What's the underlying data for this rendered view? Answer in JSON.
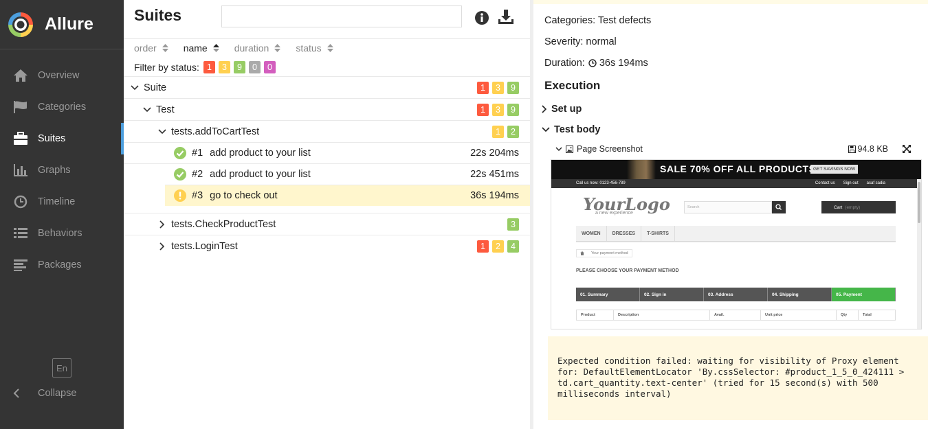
{
  "brand": {
    "name": "Allure"
  },
  "sidebar": {
    "items": [
      {
        "label": "Overview",
        "icon": "home-icon"
      },
      {
        "label": "Categories",
        "icon": "flag-icon"
      },
      {
        "label": "Suites",
        "icon": "briefcase-icon"
      },
      {
        "label": "Graphs",
        "icon": "bar-chart-icon"
      },
      {
        "label": "Timeline",
        "icon": "clock-icon"
      },
      {
        "label": "Behaviors",
        "icon": "list-icon"
      },
      {
        "label": "Packages",
        "icon": "align-left-icon"
      }
    ],
    "active": "Suites",
    "language": "En",
    "collapse_label": "Collapse"
  },
  "suites": {
    "title": "Suites",
    "search_value": "",
    "sorters": [
      {
        "label": "order",
        "active": false
      },
      {
        "label": "name",
        "active": true
      },
      {
        "label": "duration",
        "active": false
      },
      {
        "label": "status",
        "active": false
      }
    ],
    "filter_label": "Filter by status:",
    "filter_counts": {
      "failed": "1",
      "broken": "3",
      "passed": "9",
      "skipped": "0",
      "unknown": "0"
    },
    "tree": {
      "suite": {
        "name": "Suite",
        "badges": [
          "1",
          "3",
          "9"
        ]
      },
      "test": {
        "name": "Test",
        "badges": [
          "1",
          "3",
          "9"
        ]
      },
      "add_to_cart": {
        "name": "tests.addToCartTest",
        "badges": [
          "1",
          "2"
        ]
      },
      "cases": [
        {
          "num": "#1",
          "name": "add product to your list",
          "duration": "22s 204ms",
          "status": "passed"
        },
        {
          "num": "#2",
          "name": "add product to your list",
          "duration": "22s 451ms",
          "status": "passed"
        },
        {
          "num": "#3",
          "name": "go to check out",
          "duration": "36s 194ms",
          "status": "broken"
        }
      ],
      "check_product": {
        "name": "tests.CheckProductTest",
        "badges": [
          "3"
        ]
      },
      "login": {
        "name": "tests.LoginTest",
        "badges": [
          "1",
          "2",
          "4"
        ]
      }
    }
  },
  "detail": {
    "categories": "Categories: Test defects",
    "severity": "Severity: normal",
    "duration_label": "Duration:",
    "duration_value": "36s 194ms",
    "execution_title": "Execution",
    "setup_label": "Set up",
    "body_label": "Test body",
    "attachment": {
      "name": "Page Screenshot",
      "size": "94.8 KB"
    },
    "screenshot": {
      "banner": "SALE 70% OFF ALL PRODUCTS",
      "banner_button": "GET SAVINGS NOW",
      "call_us": "Call us now: 0123-456-789",
      "top_links": [
        "Contact us",
        "Sign out",
        "asaf sadia"
      ],
      "logo": "YourLogo",
      "logo_sub": "a new experience",
      "search_placeholder": "Search",
      "cart": "Cart",
      "cart_sub": "(empty)",
      "menu": [
        "WOMEN",
        "DRESSES",
        "T-SHIRTS"
      ],
      "breadcrumb": "Your payment method",
      "heading": "PLEASE CHOOSE YOUR PAYMENT METHOD",
      "steps": [
        "01. Summary",
        "02. Sign in",
        "03. Address",
        "04. Shipping",
        "05. Payment"
      ],
      "table_headers": [
        "Product",
        "Description",
        "Avail.",
        "Unit price",
        "Qty",
        "Total"
      ]
    },
    "error": "Expected condition failed: waiting for visibility of Proxy element\nfor: DefaultElementLocator 'By.cssSelector: #product_1_5_0_424111 >\ntd.cart_quantity.text-center' (tried for 15 second(s) with 500\nmilliseconds interval)"
  },
  "colors": {
    "failed": "#fd5a3e",
    "broken": "#ffd050",
    "passed": "#97cc64",
    "skipped": "#aaaaaa",
    "unknown": "#d35ebe",
    "accent": "#4c9edd"
  }
}
